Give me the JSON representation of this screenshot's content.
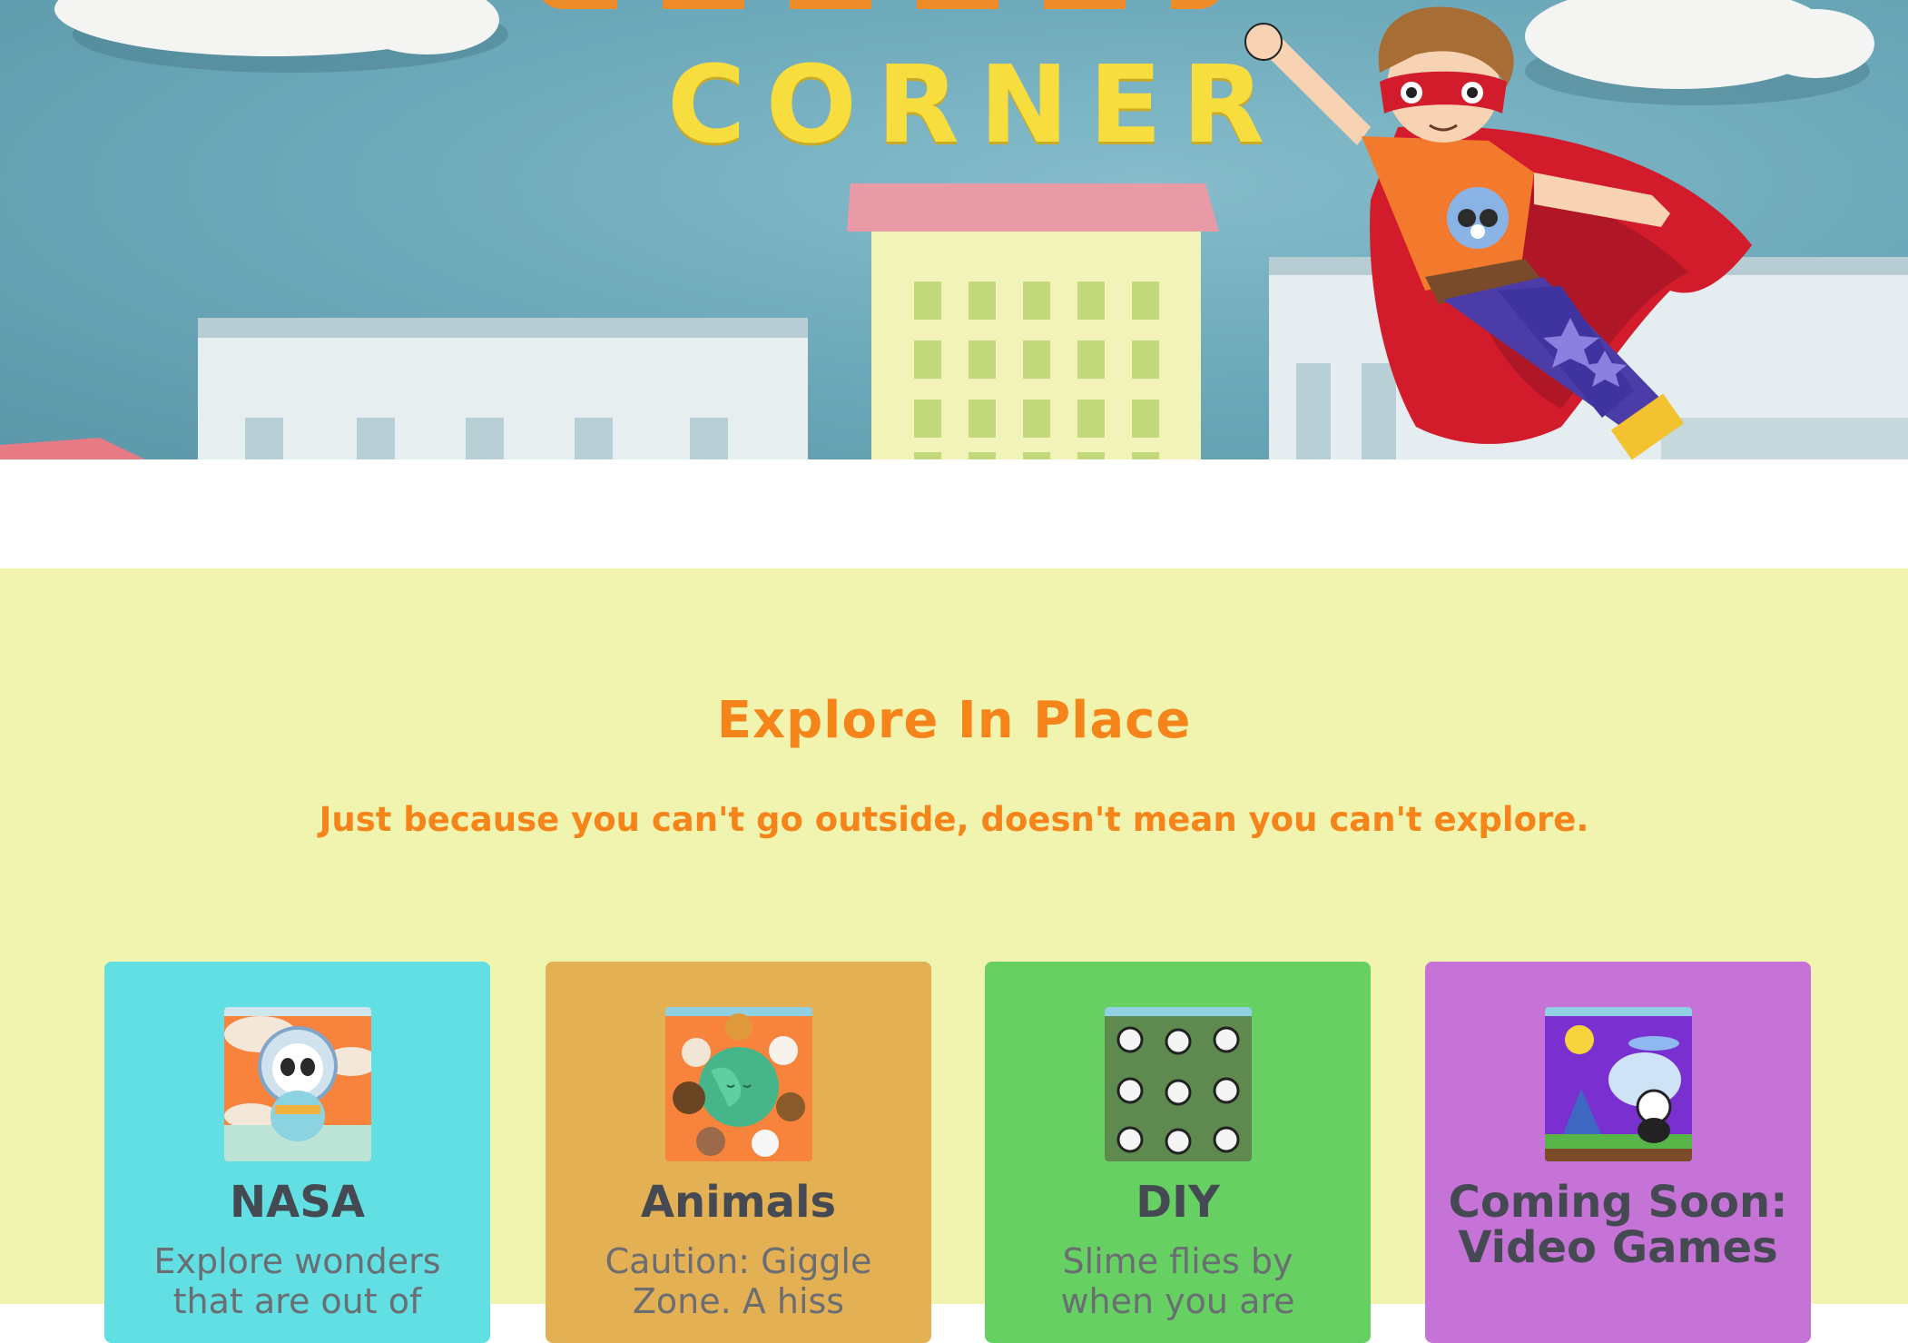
{
  "hero": {
    "title": "CORNER"
  },
  "explore": {
    "heading": "Explore In Place",
    "subheading": "Just because you can't go outside, doesn't mean you can't explore."
  },
  "cards": [
    {
      "title": "NASA",
      "description": "Explore wonders that are out of",
      "color": "#62dfe2",
      "icon": "panda-astronaut-icon"
    },
    {
      "title": "Animals",
      "description": "Caution: Giggle Zone. A hiss",
      "color": "#e4b054",
      "icon": "animals-globe-icon"
    },
    {
      "title": "DIY",
      "description": "Slime flies by when you are",
      "color": "#67d062",
      "icon": "panda-grid-icon"
    },
    {
      "title": "Coming Soon: Video Games",
      "description": "",
      "color": "#c673d7",
      "icon": "video-game-panda-icon"
    }
  ],
  "colors": {
    "sky": "#6aa7b8",
    "title_yellow": "#f8dd3e",
    "section_bg": "#f1f4ae",
    "heading_orange": "#f5841a",
    "cape_red": "#d31c2b"
  }
}
